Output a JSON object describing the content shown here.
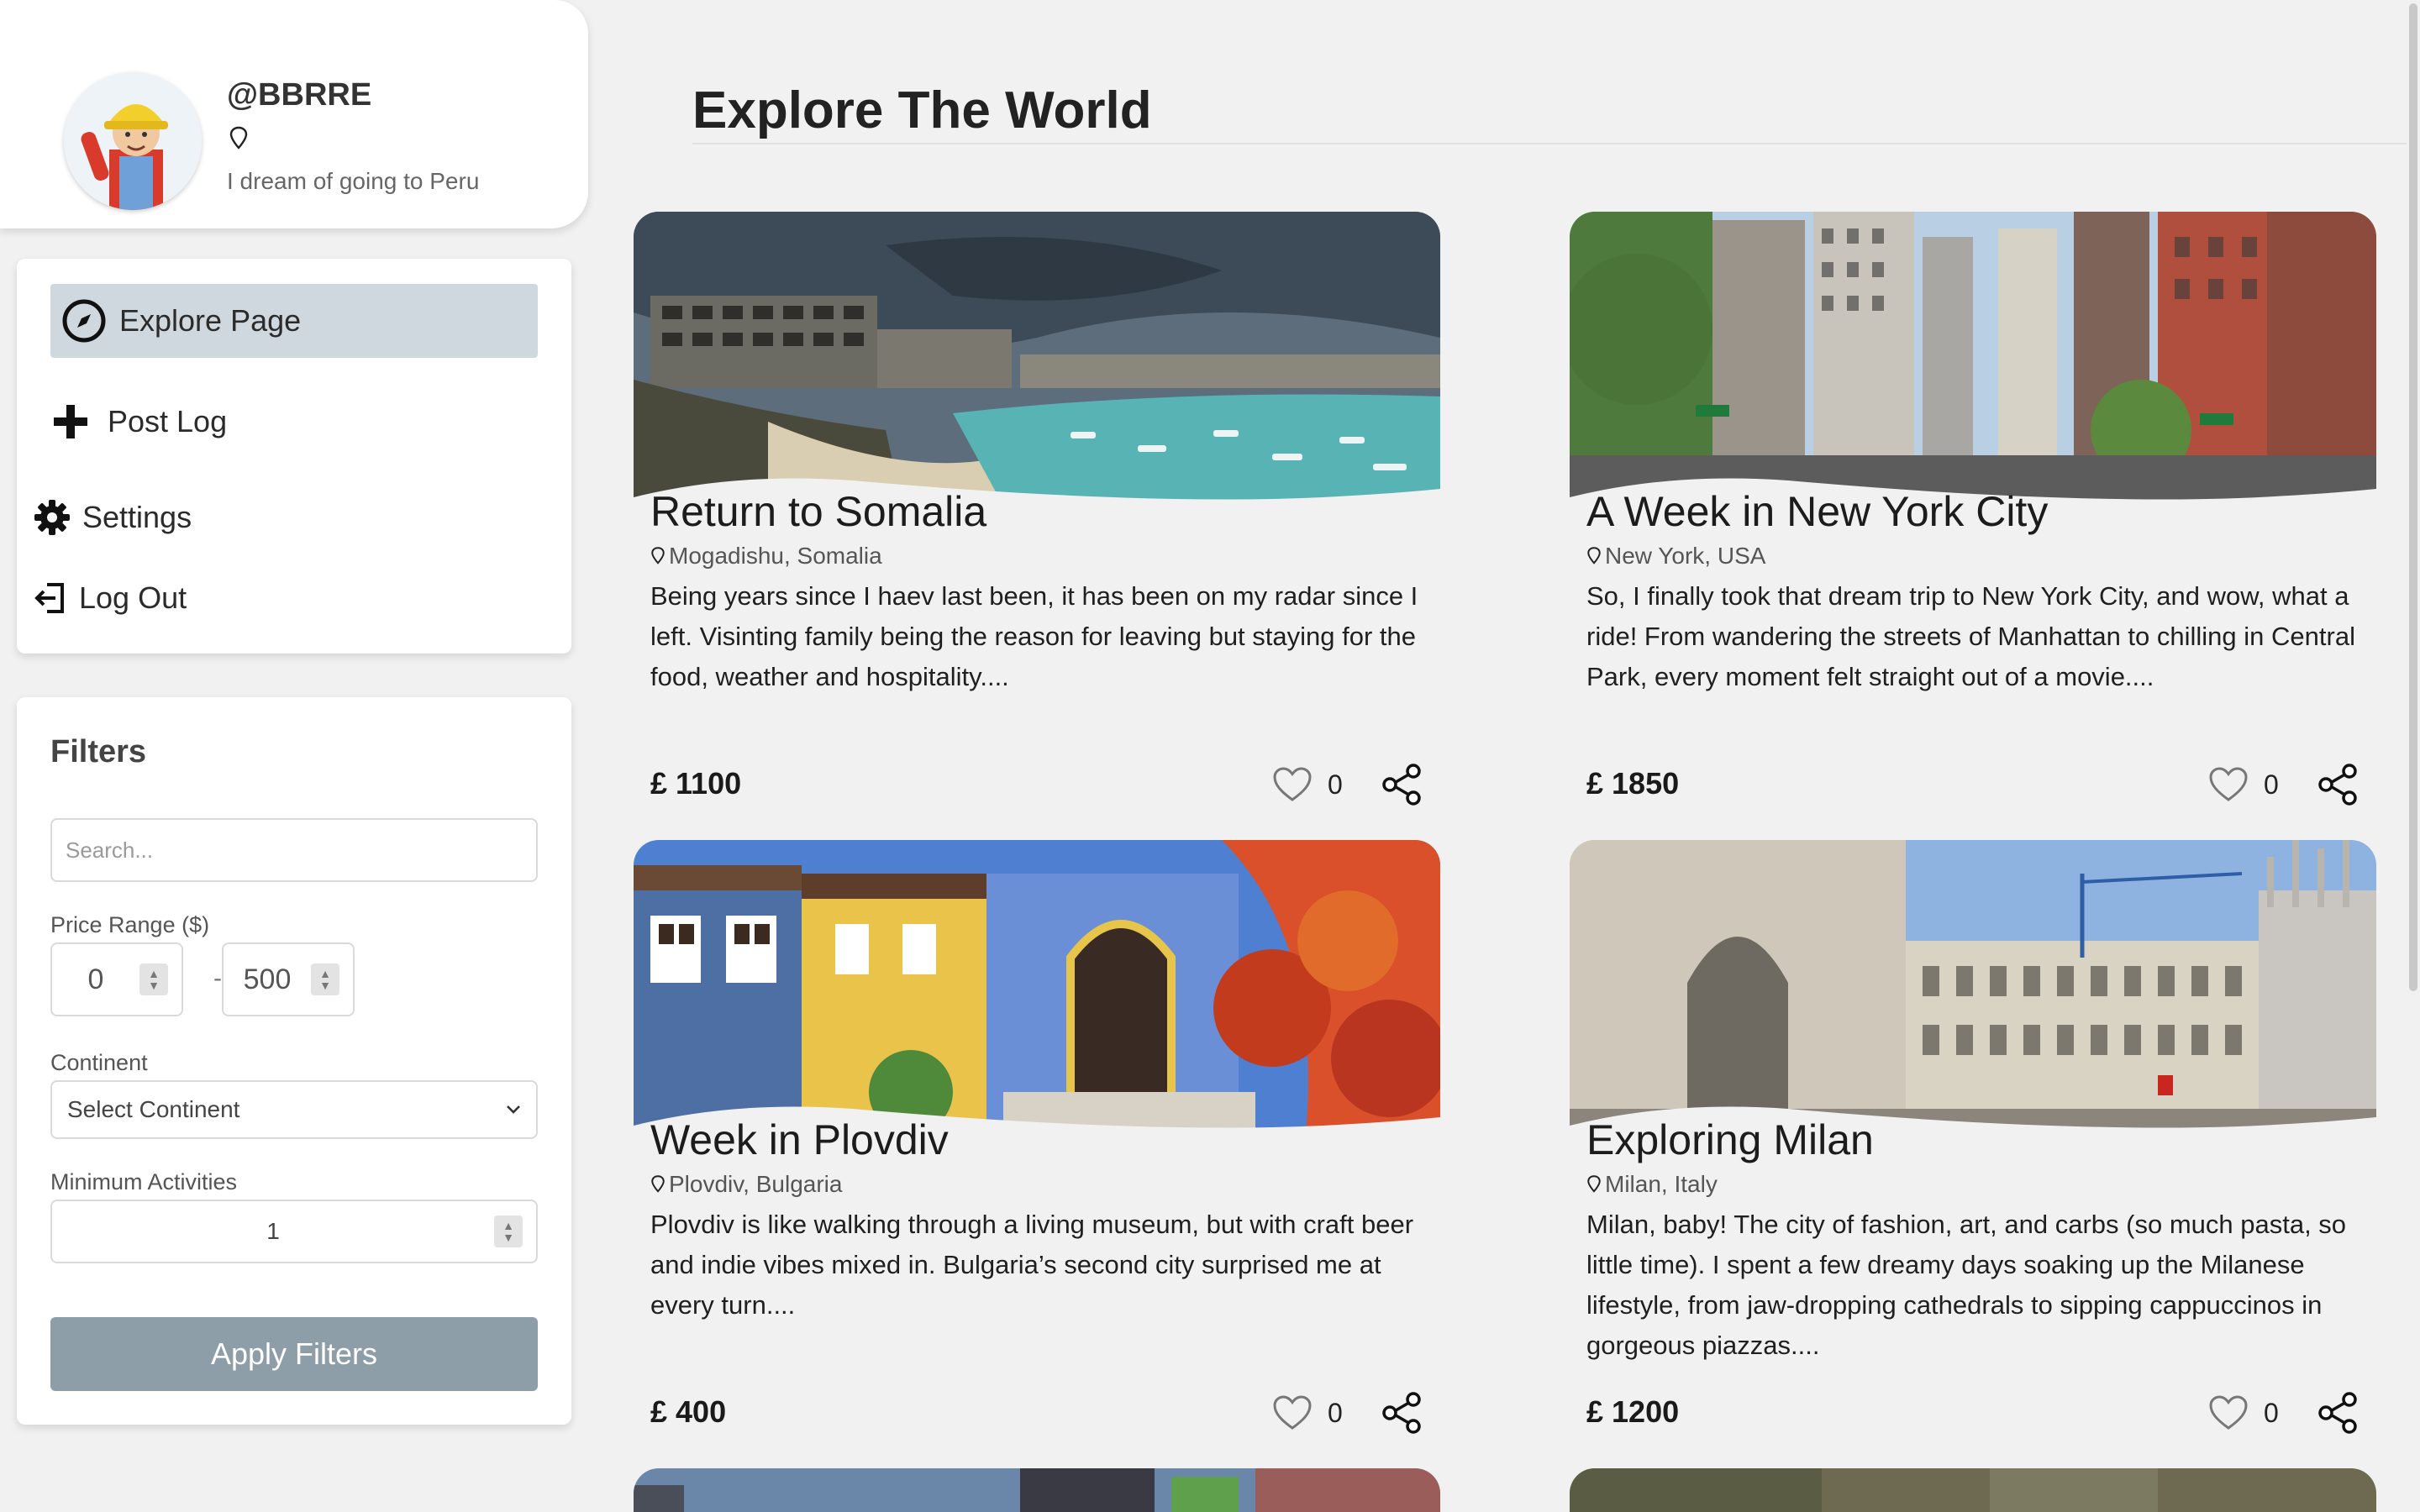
{
  "profile": {
    "username": "@BBRRE",
    "location": "",
    "bio": "I dream of going to Peru"
  },
  "nav": {
    "explore": "Explore Page",
    "post_log": "Post Log",
    "settings": "Settings",
    "logout": "Log Out"
  },
  "filters": {
    "title": "Filters",
    "search_placeholder": "Search...",
    "price_label": "Price Range ($)",
    "price_min": "0",
    "price_max": "500",
    "dash": "-",
    "continent_label": "Continent",
    "continent_value": "Select Continent",
    "min_activities_label": "Minimum Activities",
    "min_activities_value": "1",
    "apply_label": "Apply Filters"
  },
  "main": {
    "title": "Explore The World",
    "posts": [
      {
        "title": "Return to Somalia",
        "location": "Mogadishu, Somalia",
        "description": "Being years since I haev last been, it has been on my radar since I left. Visinting family being the reason for leaving but staying for the food, weather and hospitality....",
        "price": "£ 1100",
        "likes": "0"
      },
      {
        "title": "A Week in New York City",
        "location": "New York, USA",
        "description": "So, I finally took that dream trip to New York City, and wow, what a ride! From wandering the streets of Manhattan to chilling in Central Park, every moment felt straight out of a movie....",
        "price": "£ 1850",
        "likes": "0"
      },
      {
        "title": "Week in Plovdiv",
        "location": "Plovdiv, Bulgaria",
        "description": "Plovdiv is like walking through a living museum, but with craft beer and indie vibes mixed in. Bulgaria’s second city surprised me at every turn....",
        "price": "£ 400",
        "likes": "0"
      },
      {
        "title": "Exploring Milan",
        "location": "Milan, Italy",
        "description": "Milan, baby! The city of fashion, art, and carbs (so much pasta, so little time). I spent a few dreamy days soaking up the Milanese lifestyle, from jaw-dropping cathedrals to sipping cappuccinos in gorgeous piazzas....",
        "price": "£ 1200",
        "likes": "0"
      }
    ]
  },
  "icons": {
    "explore": "compass-icon",
    "post": "plus-icon",
    "settings": "gear-icon",
    "logout": "logout-icon",
    "location": "map-pin-icon",
    "like": "heart-icon",
    "share": "share-icon"
  },
  "colors": {
    "active_nav": "#cfd8df",
    "apply_button": "#8d9ea8",
    "background": "#f1f1f1"
  }
}
